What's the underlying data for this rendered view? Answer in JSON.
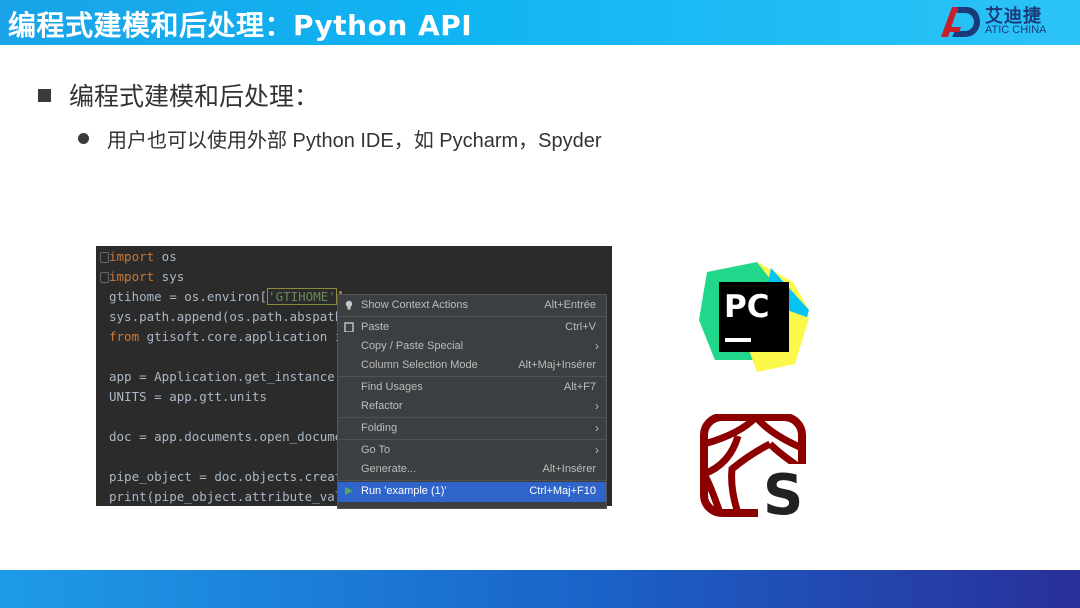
{
  "header": {
    "title": "编程式建模和后处理：Python API"
  },
  "logo": {
    "cn": "艾迪捷",
    "en": "ATIC CHINA"
  },
  "bullets": {
    "level1": "编程式建模和后处理：",
    "level2": "用户也可以使用外部 Python IDE，如 Pycharm，Spyder"
  },
  "editor": {
    "lines": [
      {
        "kw": "import",
        "rest": " os"
      },
      {
        "kw": "import",
        "rest": " sys"
      },
      {
        "pre": "gtihome = os.environ[",
        "str": "'GTIHOME'",
        "post": "]"
      },
      {
        "pre": "sys.path.append(os.path.abspath"
      },
      {
        "kw": "from",
        "rest": " gtisoft.core.application i"
      },
      {
        "pre": ""
      },
      {
        "pre": "app = Application.get_instance("
      },
      {
        "pre": "UNITS = app.gtt.units"
      },
      {
        "pre": ""
      },
      {
        "pre": "doc = app.documents.open_documen"
      },
      {
        "pre": ""
      },
      {
        "pre": "pipe_object = doc.objects.create"
      },
      {
        "pre": "print(pipe_object.attribute_valu"
      }
    ]
  },
  "context_menu": {
    "items": [
      {
        "label": "Show Context Actions",
        "shortcut": "Alt+Entrée"
      },
      {
        "label": "Paste",
        "shortcut": "Ctrl+V"
      },
      {
        "label": "Copy / Paste Special",
        "shortcut": ""
      },
      {
        "label": "Column Selection Mode",
        "shortcut": "Alt+Maj+Insérer"
      },
      {
        "label": "Find Usages",
        "shortcut": "Alt+F7"
      },
      {
        "label": "Refactor",
        "shortcut": ""
      },
      {
        "label": "Folding",
        "shortcut": ""
      },
      {
        "label": "Go To",
        "shortcut": ""
      },
      {
        "label": "Generate...",
        "shortcut": "Alt+Insérer"
      },
      {
        "label": "Run 'example (1)'",
        "shortcut": "Ctrl+Maj+F10"
      }
    ]
  },
  "icons": {
    "pycharm": "pycharm-logo",
    "spyder": "spyder-logo",
    "run": "run-triangle-icon",
    "paste": "paste-icon",
    "bulb": "lightbulb-icon"
  },
  "logos": {
    "pycharm_text": "PC",
    "spyder_text": "S"
  },
  "colors": {
    "accent": "#0fb4f2",
    "menu_active": "#2f65ca",
    "code_bg": "#2b2b2b"
  }
}
